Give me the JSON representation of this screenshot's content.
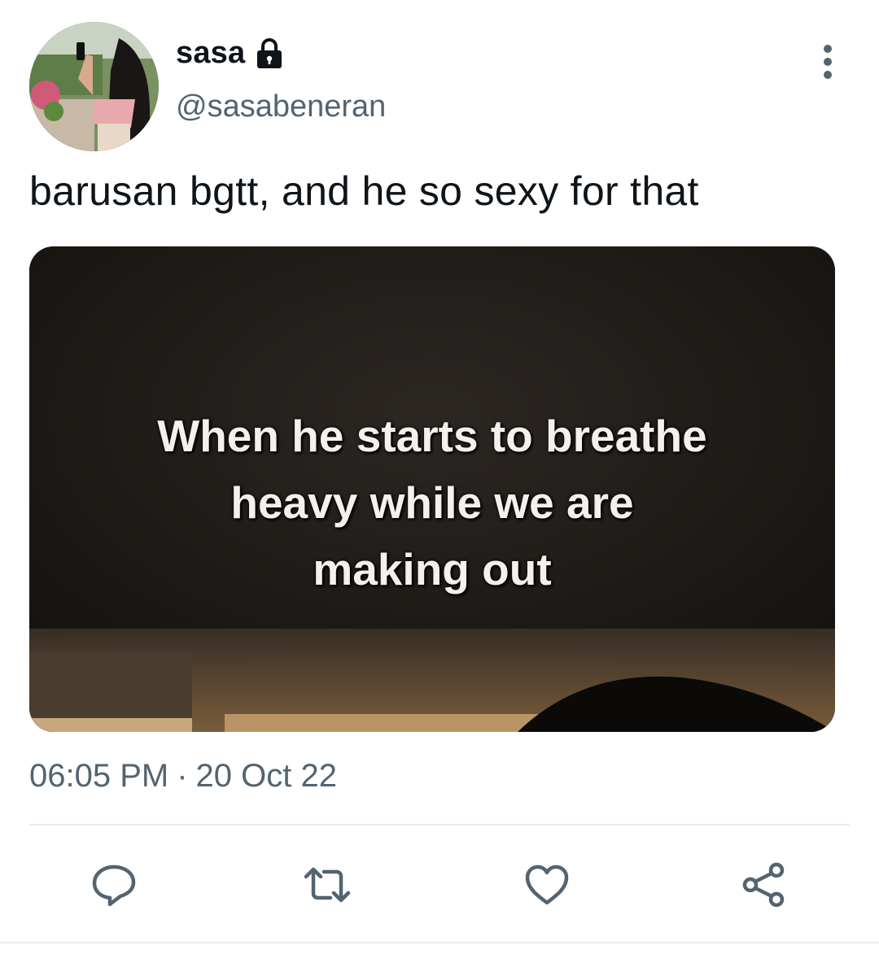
{
  "tweet": {
    "display_name": "sasa",
    "handle": "@sasabeneran",
    "protected_icon": "lock-icon",
    "text": "barusan bgtt, and he so sexy for that",
    "media": {
      "caption_lines": [
        "When he starts to breathe",
        "heavy while we are",
        "making out"
      ]
    },
    "time": "06:05 PM",
    "separator": "·",
    "date": "20 Oct 22"
  },
  "actions": [
    {
      "icon": "reply-icon"
    },
    {
      "icon": "retweet-icon"
    },
    {
      "icon": "like-icon"
    },
    {
      "icon": "share-icon"
    }
  ],
  "colors": {
    "text_primary": "#0f1419",
    "text_secondary": "#536471",
    "divider": "#e6ecf0",
    "media_bg": "#1e1b19"
  }
}
